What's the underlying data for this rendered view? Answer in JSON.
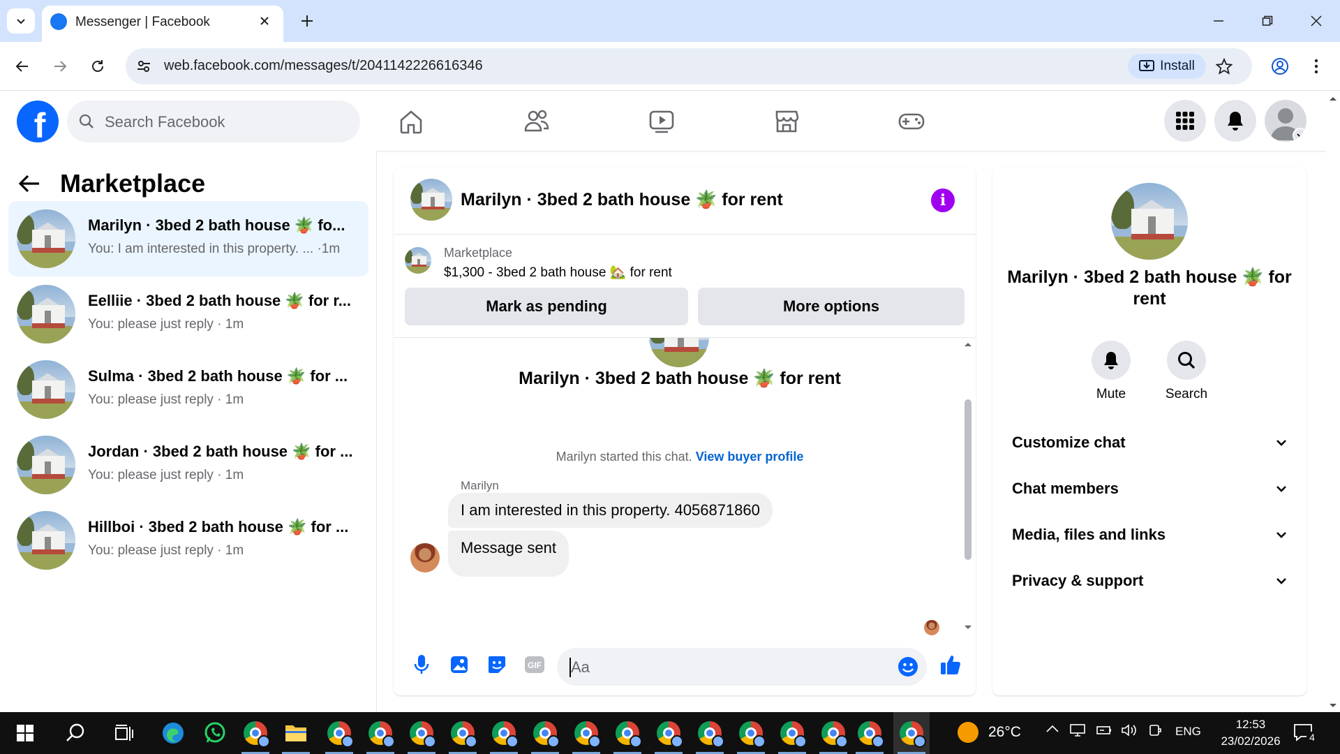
{
  "browser": {
    "tab_title": "Messenger | Facebook",
    "url": "web.facebook.com/messages/t/2041142226616346",
    "install_label": "Install"
  },
  "fb": {
    "logo_letter": "f",
    "search_placeholder": "Search Facebook",
    "nav_icons": [
      "home-icon",
      "friends-icon",
      "video-icon",
      "marketplace-icon",
      "gaming-icon"
    ]
  },
  "sidebar": {
    "title": "Marketplace",
    "conversations": [
      {
        "name": "Marilyn · 3bed 2 bath house 🪴 fo...",
        "preview": "You: I am interested in this property. ... ·1m",
        "active": true
      },
      {
        "name": "Eelliie · 3bed 2 bath house 🪴 for r...",
        "preview": "You: please just reply · 1m",
        "active": false
      },
      {
        "name": "Sulma · 3bed 2 bath house 🪴 for ...",
        "preview": "You: please just reply · 1m",
        "active": false
      },
      {
        "name": "Jordan · 3bed 2 bath house 🪴 for ...",
        "preview": "You: please just reply · 1m",
        "active": false
      },
      {
        "name": "Hillboi · 3bed 2 bath house 🪴 for ...",
        "preview": "You: please just reply · 1m",
        "active": false
      }
    ]
  },
  "chat": {
    "header_title": "Marilyn · 3bed 2 bath house 🪴 for rent",
    "info_icon": "i",
    "marketplace_label": "Marketplace",
    "listing": "$1,300 - 3bed 2 bath house 🏡 for rent",
    "mark_pending_label": "Mark as pending",
    "more_options_label": "More options",
    "body_title": "Marilyn · 3bed 2 bath house 🪴 for rent",
    "started_text": "Marilyn started this chat.",
    "view_buyer_profile": "View buyer profile",
    "sender_name": "Marilyn",
    "messages": [
      "I am interested in this property. 4056871860",
      "Message sent"
    ],
    "input_placeholder": "Aa"
  },
  "details": {
    "title": "Marilyn · 3bed 2 bath house 🪴 for rent",
    "mute_label": "Mute",
    "search_label": "Search",
    "sections": [
      "Customize chat",
      "Chat members",
      "Media, files and links",
      "Privacy & support"
    ]
  },
  "taskbar": {
    "temperature": "26°C",
    "language": "ENG",
    "time": "12:53",
    "date": "23/02/2026",
    "notification_count": "4"
  },
  "colors": {
    "fb_blue": "#0866ff",
    "active_conversation": "#ebf5ff",
    "info_purple": "#a000f0",
    "link_blue": "#0064d1"
  }
}
